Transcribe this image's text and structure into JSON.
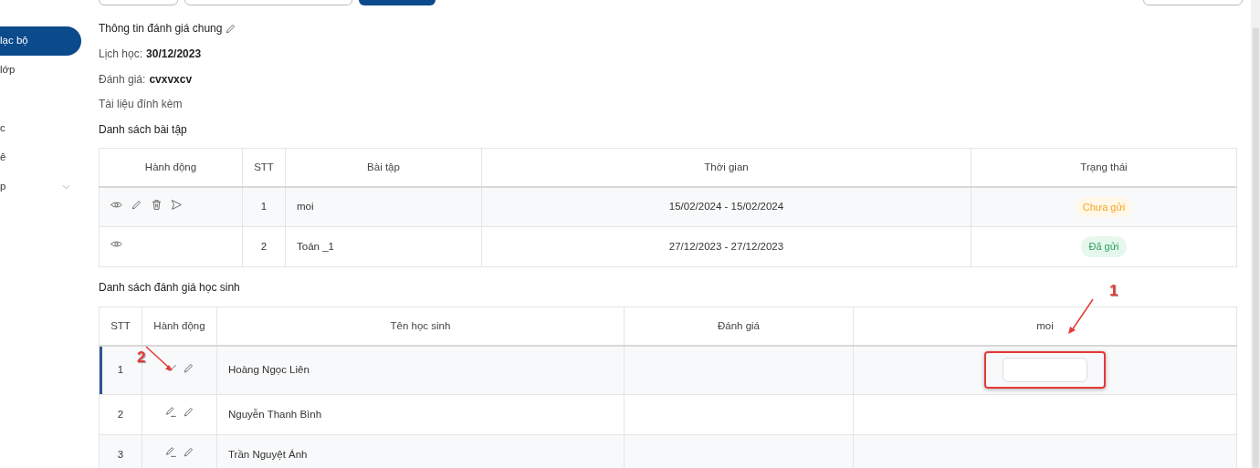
{
  "top_controls": [
    {
      "kind": "outline-button"
    },
    {
      "kind": "field"
    },
    {
      "kind": "primary-button"
    },
    {
      "kind": "spacer"
    },
    {
      "kind": "outline-button"
    }
  ],
  "sidebar": {
    "groups": [
      [
        {
          "label": "lạc bộ",
          "selected": true
        },
        {
          "label": "lớp",
          "selected": false
        }
      ],
      [
        {
          "label": "c",
          "selected": false
        },
        {
          "label": "ê",
          "selected": false
        },
        {
          "label": "p",
          "selected": false,
          "expandable": true
        }
      ]
    ]
  },
  "general_info": {
    "title": "Thông tin đánh giá chung",
    "fields": [
      {
        "label": "Lịch học:",
        "value": "30/12/2023"
      },
      {
        "label": "Đánh giá:",
        "value": "cvxvxcv"
      }
    ],
    "attachments_label": "Tài liệu đính kèm"
  },
  "assignments": {
    "title": "Danh sách bài tập",
    "columns": [
      "Hành động",
      "STT",
      "Bài tập",
      "Thời gian",
      "Trạng thái"
    ],
    "rows": [
      {
        "actions": [
          {
            "kind": "view"
          },
          {
            "kind": "edit"
          },
          {
            "kind": "delete"
          },
          {
            "kind": "send"
          }
        ],
        "stt": "1",
        "name": "moi",
        "time": "15/02/2024 - 15/02/2024",
        "status": {
          "text": "Chưa gửi",
          "kind": "pending"
        }
      },
      {
        "actions": [
          {
            "kind": "view"
          }
        ],
        "stt": "2",
        "name": "Toán _1",
        "time": "27/12/2023 - 27/12/2023",
        "status": {
          "text": "Đã gửi",
          "kind": "sent"
        }
      }
    ]
  },
  "students": {
    "title": "Danh sách đánh giá học sinh",
    "columns": [
      "STT",
      "Hành động",
      "Tên học sinh",
      "Đánh giá",
      "moi"
    ],
    "rows": [
      {
        "stt": "1",
        "actions": [
          {
            "kind": "save"
          },
          {
            "kind": "edit"
          }
        ],
        "name": "Hoàng Ngọc Liên",
        "editing": true,
        "selected": true
      },
      {
        "stt": "2",
        "actions": [
          {
            "kind": "edit-line"
          },
          {
            "kind": "edit"
          }
        ],
        "name": "Nguyễn Thanh Bình",
        "editing": false,
        "selected": false
      },
      {
        "stt": "3",
        "actions": [
          {
            "kind": "edit-line"
          },
          {
            "kind": "edit"
          }
        ],
        "name": "Trần Nguyệt Ánh",
        "editing": false,
        "selected": false
      }
    ]
  },
  "annotations": [
    {
      "kind": "number",
      "text": "1"
    },
    {
      "kind": "number",
      "text": "2"
    }
  ]
}
